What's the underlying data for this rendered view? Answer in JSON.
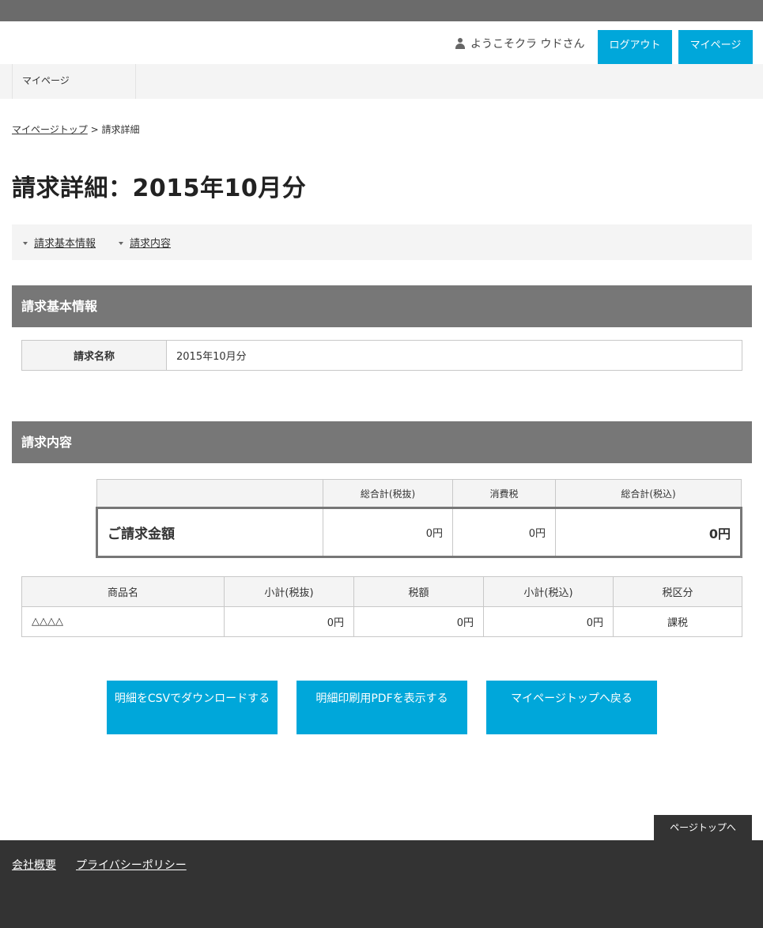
{
  "header": {
    "welcome_text": "ようこそクラ ウドさん",
    "logout_label": "ログアウト",
    "mypage_label": "マイページ"
  },
  "gnav": {
    "items": [
      {
        "label": "マイページ"
      }
    ]
  },
  "breadcrumb": {
    "home_label": "マイページトップ",
    "separator": ">",
    "current": "請求詳細"
  },
  "page_title": "請求詳細：2015年10月分",
  "anchor_nav": [
    {
      "label": "請求基本情報"
    },
    {
      "label": "請求内容"
    }
  ],
  "basic_info": {
    "heading": "請求基本情報",
    "rows": [
      {
        "label": "請求名称",
        "value": "2015年10月分"
      }
    ]
  },
  "billing": {
    "heading": "請求内容",
    "summary": {
      "headers": [
        "",
        "総合計(税抜)",
        "消費税",
        "総合計(税込)"
      ],
      "row_label": "ご請求金額",
      "subtotal": "0円",
      "tax": "0円",
      "total": "0円"
    },
    "items": {
      "headers": [
        "商品名",
        "小計(税抜)",
        "税額",
        "小計(税込)",
        "税区分"
      ],
      "rows": [
        {
          "name": "△△△△",
          "subtotal": "0円",
          "tax": "0円",
          "total": "0円",
          "tax_type": "課税"
        }
      ]
    }
  },
  "actions": {
    "csv_label": "明細をCSVでダウンロードする",
    "pdf_label": "明細印刷用PDFを表示する",
    "back_label": "マイページトップへ戻る"
  },
  "pagetop_label": "ページトップへ",
  "footer": {
    "links": [
      {
        "label": "会社概要"
      },
      {
        "label": "プライバシーポリシー"
      }
    ]
  },
  "colors": {
    "accent": "#00a7da",
    "top_strip": "#6b6b6b",
    "section_header": "#777777",
    "footer": "#333333"
  }
}
